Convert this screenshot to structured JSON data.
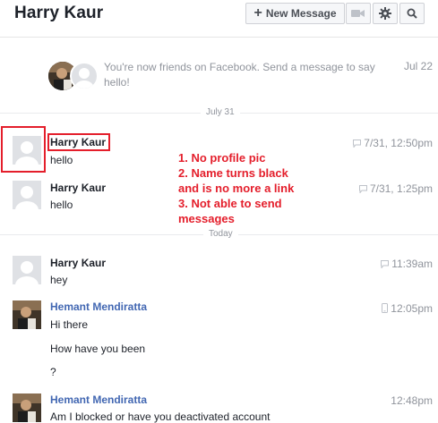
{
  "header": {
    "title": "Harry Kaur",
    "new_message_label": "New Message",
    "buttons": [
      "video-icon",
      "gear-icon",
      "search-icon"
    ]
  },
  "notice": {
    "text": "You're now friends on Facebook. Send a message to say hello!",
    "time": "Jul 22"
  },
  "dividers": {
    "day1": "July 31",
    "day2": "Today"
  },
  "messages": [
    {
      "sender": "Harry Kaur",
      "text": "hello",
      "time": "7/31, 12:50pm",
      "icon": "chat-icon"
    },
    {
      "sender": "Harry Kaur",
      "text": "hello",
      "time": "7/31, 1:25pm",
      "icon": "chat-icon"
    },
    {
      "sender": "Harry Kaur",
      "text": "hey",
      "time": "11:39am",
      "icon": "chat-icon"
    },
    {
      "sender": "Hemant Mendiratta",
      "lines": [
        "Hi there",
        "How have you been",
        "?"
      ],
      "time": "12:05pm",
      "icon": "mobile-icon"
    },
    {
      "sender": "Hemant Mendiratta",
      "text": "Am I blocked or have you deactivated account",
      "time": "12:48pm"
    }
  ],
  "annotation": {
    "lines": [
      "1. No profile pic",
      "2. Name turns black",
      "and is no more a link",
      "3. Not able to send",
      "messages"
    ]
  },
  "colors": {
    "link": "#4267b2",
    "annotation_red": "#e41e2b",
    "meta_gray": "#90949c"
  }
}
